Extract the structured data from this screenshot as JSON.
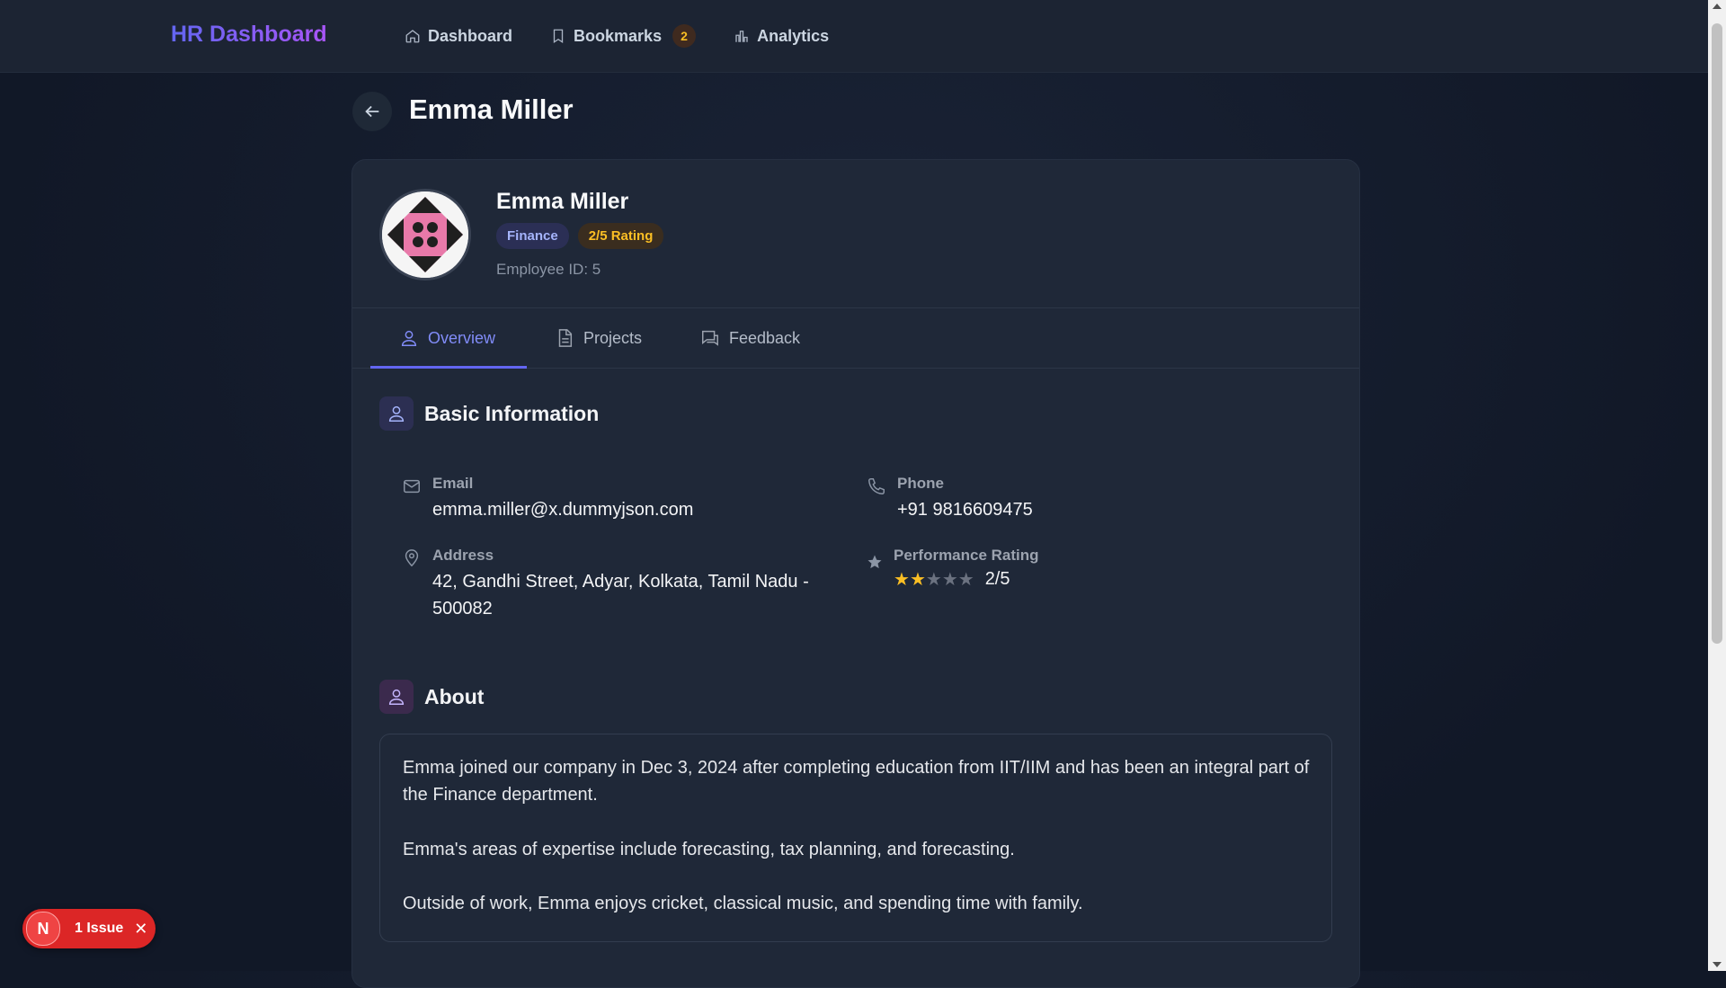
{
  "app": {
    "brand": "HR Dashboard"
  },
  "nav": {
    "items": [
      {
        "label": "Dashboard",
        "icon": "home-icon"
      },
      {
        "label": "Bookmarks",
        "icon": "bookmark-icon",
        "count": "2"
      },
      {
        "label": "Analytics",
        "icon": "bar-chart-icon"
      }
    ]
  },
  "page": {
    "title": "Emma Miller"
  },
  "profile": {
    "name": "Emma Miller",
    "department": "Finance",
    "rating_badge": "2/5 Rating",
    "employee_id": "Employee ID: 5"
  },
  "tabs": [
    {
      "label": "Overview",
      "icon": "user-icon",
      "active": true
    },
    {
      "label": "Projects",
      "icon": "document-icon",
      "active": false
    },
    {
      "label": "Feedback",
      "icon": "chat-icon",
      "active": false
    }
  ],
  "basic_info": {
    "title": "Basic Information",
    "email_label": "Email",
    "email": "emma.miller@x.dummyjson.com",
    "phone_label": "Phone",
    "phone": "+91 9816609475",
    "address_label": "Address",
    "address": "42, Gandhi Street, Adyar, Kolkata, Tamil Nadu - 500082",
    "rating_label": "Performance Rating",
    "rating_value": 2,
    "rating_max": 5,
    "rating_text": "2/5"
  },
  "about": {
    "title": "About",
    "paragraphs": [
      "Emma joined our company in Dec 3, 2024 after completing education from IIT/IIM and has been an integral part of the Finance department.",
      "Emma's areas of expertise include forecasting, tax planning, and forecasting.",
      "Outside of work, Emma enjoys cricket, classical music, and spending time with family."
    ]
  },
  "issue_badge": {
    "letter": "N",
    "label": "1 Issue",
    "close": "✕"
  },
  "colors": {
    "accent": "#6366f1",
    "brand": "#8b5cf6",
    "star": "#fbbf24",
    "issue": "#dc2626"
  }
}
